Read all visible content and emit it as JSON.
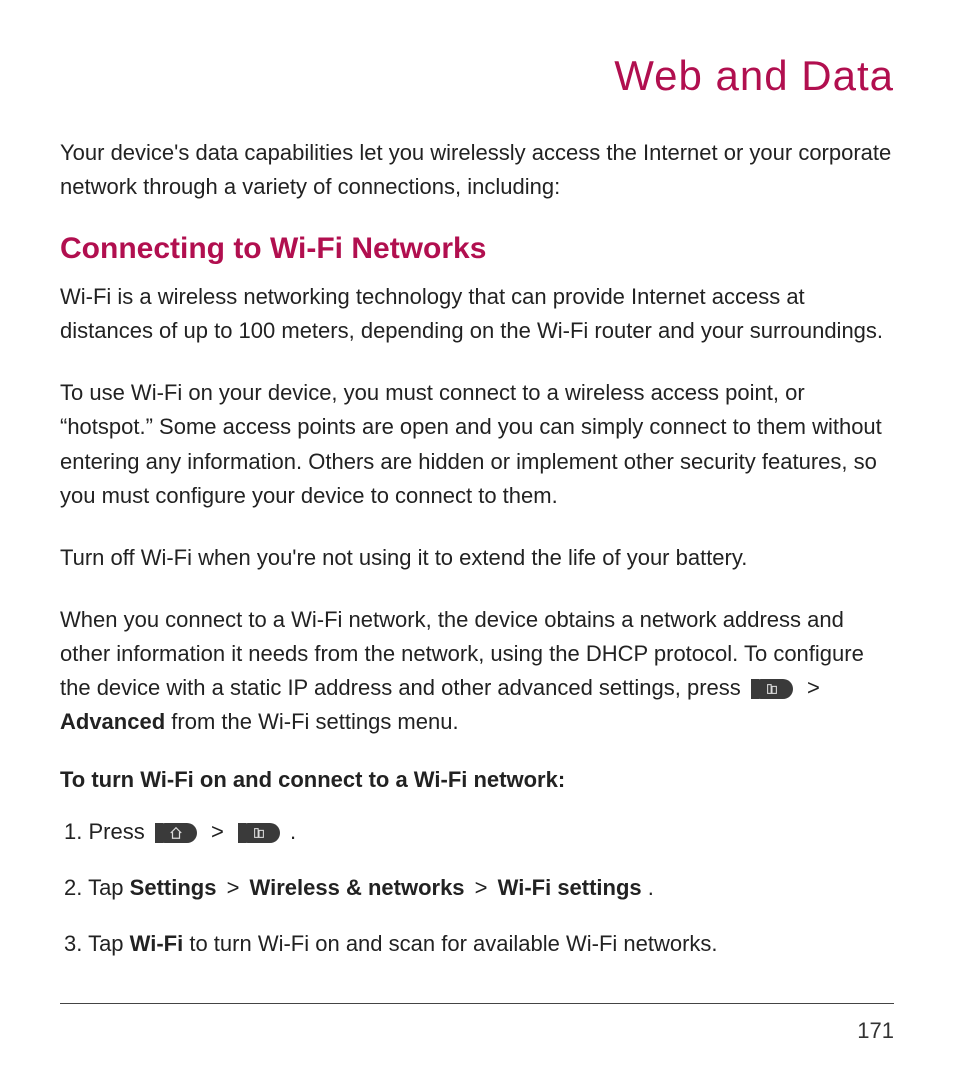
{
  "title": "Web and Data",
  "intro": "Your device's data capabilities let you wirelessly access the Internet or your corporate network through a variety of connections, including:",
  "section_heading": "Connecting to Wi-Fi Networks",
  "p1": "Wi-Fi is a wireless networking technology that can provide Internet access at distances of up to 100 meters, depending on the Wi-Fi router and your surroundings.",
  "p2": "To use Wi-Fi on your device, you must connect to a wireless access point, or “hotspot.” Some access points are open and you can simply connect to them without entering any information. Others are hidden or implement other security features, so you must configure your device to connect to them.",
  "p3": "Turn off Wi-Fi when you're not using it to extend the life of your battery.",
  "p4_a": "When you connect to a Wi-Fi network, the device obtains a network address and other information it needs from the network, using the DHCP protocol. To configure the device with a static IP address and other advanced settings, press ",
  "p4_sep": " > ",
  "p4_bold": "Advanced",
  "p4_b": " from the Wi-Fi settings menu.",
  "sub_heading": "To turn Wi-Fi on and connect to a Wi-Fi network:",
  "s1_a": "1. Press ",
  "s1_sep": "  >  ",
  "s1_end": " .",
  "s2_a": "2. Tap ",
  "s2_b1": "Settings",
  "s2_sep1": " > ",
  "s2_b2": "Wireless & networks",
  "s2_sep2": " > ",
  "s2_b3": "Wi-Fi settings",
  "s2_end": ".",
  "s3_a": "3. Tap ",
  "s3_b": "Wi-Fi",
  "s3_c": " to turn Wi-Fi on and scan for available Wi-Fi networks.",
  "page_number": "171"
}
